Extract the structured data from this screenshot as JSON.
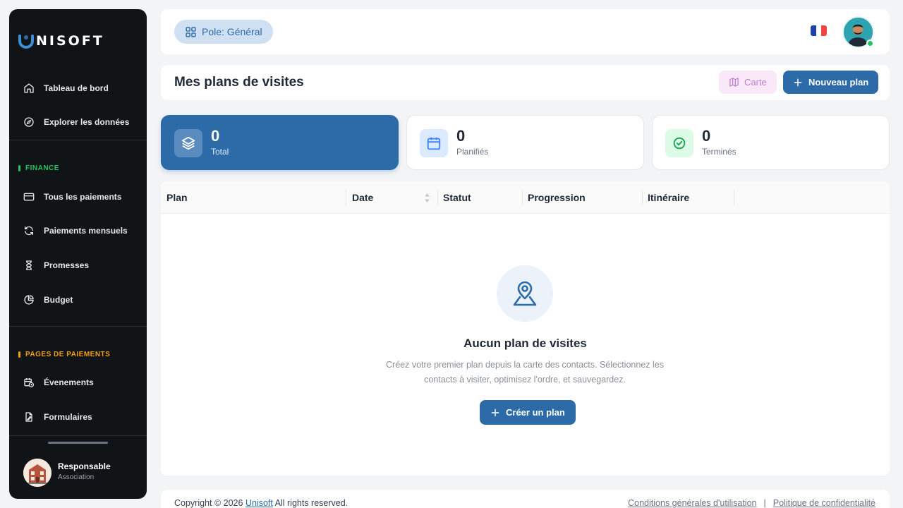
{
  "brand": {
    "name": "NISOFT"
  },
  "sidebar": {
    "main_items": [
      {
        "label": "Tableau de bord",
        "icon": "home-icon"
      },
      {
        "label": "Explorer les données",
        "icon": "compass-icon"
      }
    ],
    "finance": {
      "label": "FINANCE",
      "color": "#22c55e",
      "items": [
        {
          "label": "Tous les paiements",
          "icon": "credit-card-icon"
        },
        {
          "label": "Paiements mensuels",
          "icon": "refresh-icon"
        },
        {
          "label": "Promesses",
          "icon": "hourglass-icon"
        },
        {
          "label": "Budget",
          "icon": "pie-chart-icon"
        }
      ]
    },
    "payment_pages": {
      "label": "PAGES DE PAIEMENTS",
      "color": "#f59e0b",
      "items": [
        {
          "label": "Évenements",
          "icon": "calendar-clock-icon"
        },
        {
          "label": "Formulaires",
          "icon": "file-signature-icon"
        }
      ]
    },
    "profile": {
      "name": "Responsable",
      "role": "Association"
    }
  },
  "topbar": {
    "pole_label": "Pole: Général"
  },
  "header": {
    "title": "Mes plans de visites",
    "map_button": "Carte",
    "new_button": "Nouveau plan"
  },
  "stats": [
    {
      "value": "0",
      "label": "Total"
    },
    {
      "value": "0",
      "label": "Planifiés"
    },
    {
      "value": "0",
      "label": "Terminés"
    }
  ],
  "table": {
    "columns": [
      "Plan",
      "Date",
      "Statut",
      "Progression",
      "Itinéraire"
    ],
    "empty": {
      "title": "Aucun plan de visites",
      "description": "Créez votre premier plan depuis la carte des contacts. Sélectionnez les contacts à visiter, optimisez l'ordre, et sauvegardez.",
      "button": "Créer un plan"
    }
  },
  "footer": {
    "copyright_prefix": "Copyright © 2026",
    "copyright_link": "Unisoft",
    "copyright_suffix": "All rights reserved.",
    "terms": "Conditions générales d'utilisation",
    "separator": "|",
    "privacy": "Politique de confidentialité"
  },
  "colors": {
    "primary": "#2c6aa8",
    "sidebar_bg": "#111417",
    "map_button_bg": "#f8e8f8",
    "map_button_text": "#c07cd2",
    "online": "#22c55e"
  }
}
